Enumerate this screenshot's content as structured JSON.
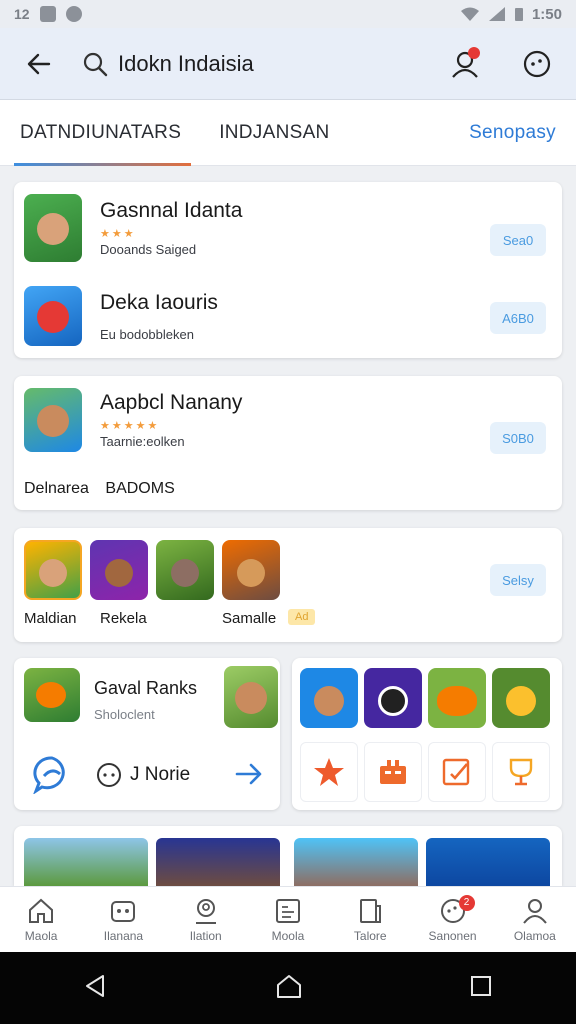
{
  "status_bar": {
    "left_text": "12",
    "time": "1:50"
  },
  "search": {
    "value": "Idokn Indaisia"
  },
  "tabs": [
    {
      "label": "DATNDIUNATARS"
    },
    {
      "label": "INDJANSAN"
    },
    {
      "label": "Senopasy"
    }
  ],
  "card1": {
    "items": [
      {
        "title": "Gasnnal Idanta",
        "stars": "★★★",
        "sub": "Dooands Saiged",
        "button": "Sea0"
      },
      {
        "title": "Deka Iaouris",
        "sub": "Eu bodobbleken",
        "button": "A6B0"
      }
    ]
  },
  "card2": {
    "title": "Aapbcl Nanany",
    "stars": "★★★★★",
    "sub": "Taarnie:eolken",
    "button": "S0B0",
    "footer_left": "Delnarea",
    "footer_right": "BADOMS"
  },
  "card3": {
    "labels": [
      "Maldian",
      "Rekela",
      "Samalle"
    ],
    "badge": "Ad",
    "button": "Selsy"
  },
  "card4": {
    "title": "Gaval Ranks",
    "sub": "Sholoclent",
    "link_label": "J Norie"
  },
  "bottom_nav": [
    {
      "label": "Maola"
    },
    {
      "label": "Ilanana"
    },
    {
      "label": "Ilation"
    },
    {
      "label": "Moola"
    },
    {
      "label": "Talore"
    },
    {
      "label": "Sanonen",
      "badge": "2"
    },
    {
      "label": "Olamoa"
    }
  ],
  "colors": {
    "accent_blue": "#2e7bd6",
    "accent_orange": "#e26e3c",
    "badge_red": "#e53935"
  }
}
